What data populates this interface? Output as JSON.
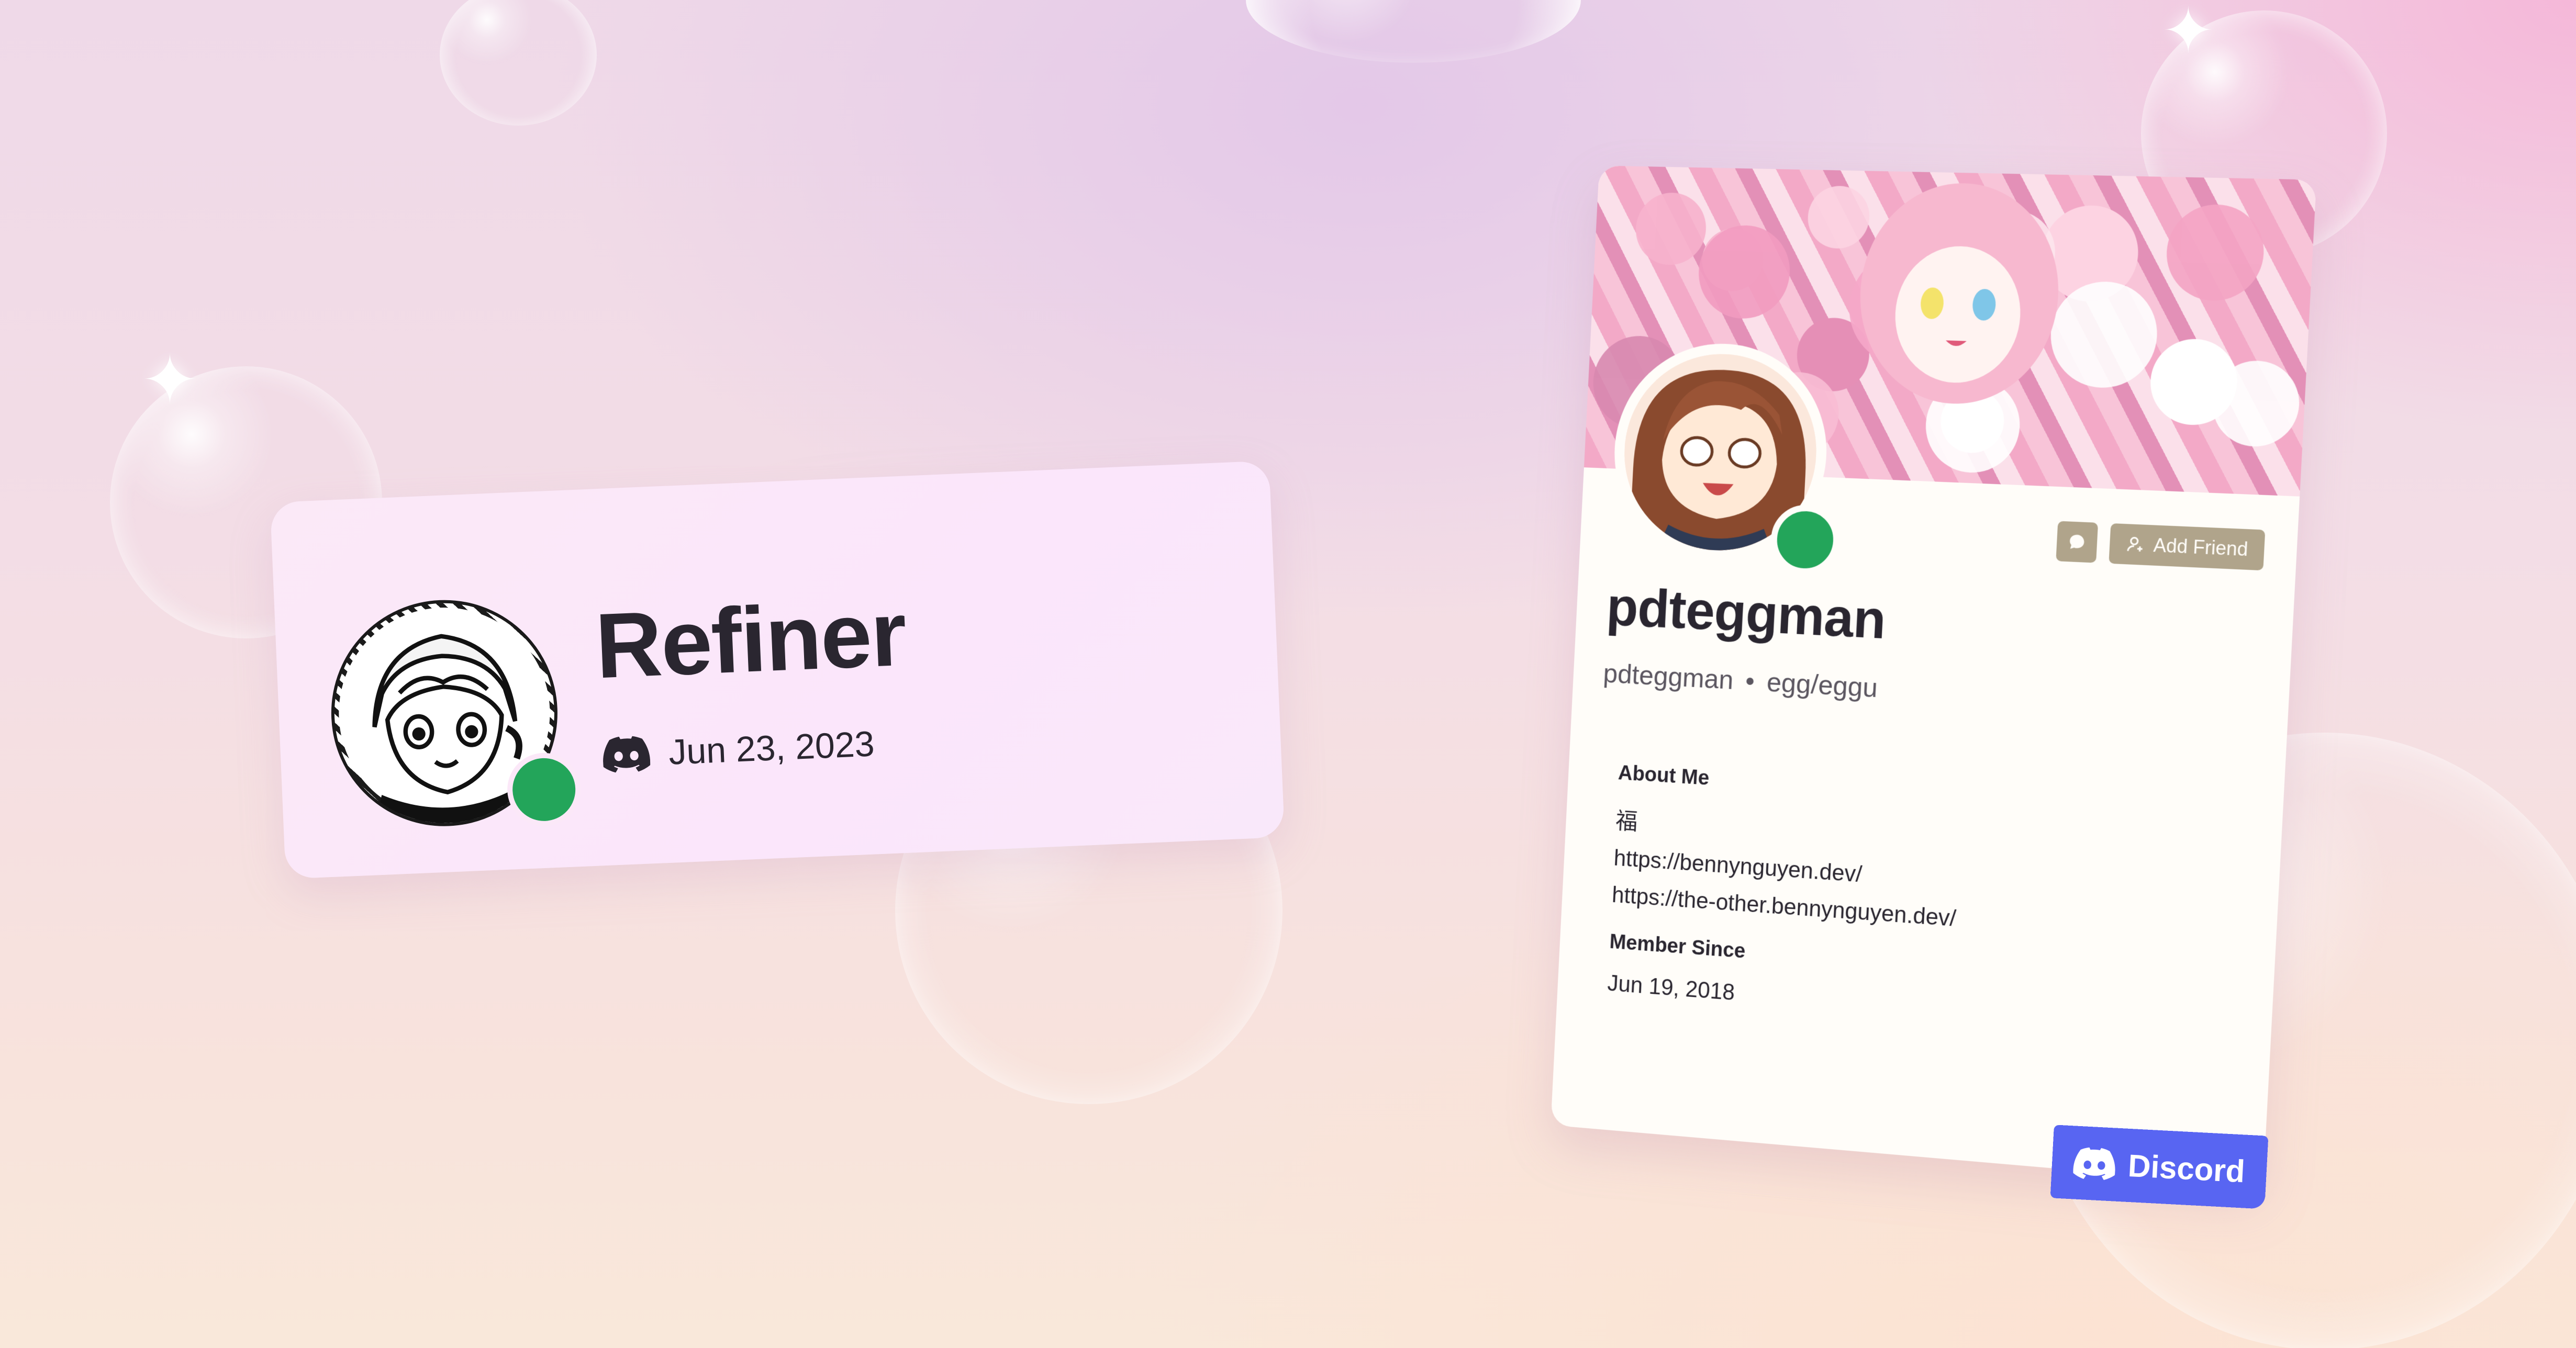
{
  "presence_card": {
    "username": "Refiner",
    "platform_icon": "discord-icon",
    "date": "Jun 23, 2023",
    "status": "online",
    "status_color": "#23a55a"
  },
  "profile_card": {
    "display_name": "pdteggman",
    "username": "pdteggman",
    "pronouns": "egg/eggu",
    "status": "online",
    "status_color": "#23a55a",
    "message_button_icon": "message-icon",
    "add_friend_label": "Add Friend",
    "add_friend_icon": "add-user-icon",
    "about_me_title": "About Me",
    "about_me_lines": [
      "福",
      "https://bennynguyen.dev/",
      "https://the-other.bennynguyen.dev/"
    ],
    "member_since_title": "Member Since",
    "member_since_date": "Jun 19, 2018",
    "button_color": "#b0a48b"
  },
  "badge": {
    "label": "Discord",
    "icon": "discord-icon",
    "color": "#5865f2"
  }
}
